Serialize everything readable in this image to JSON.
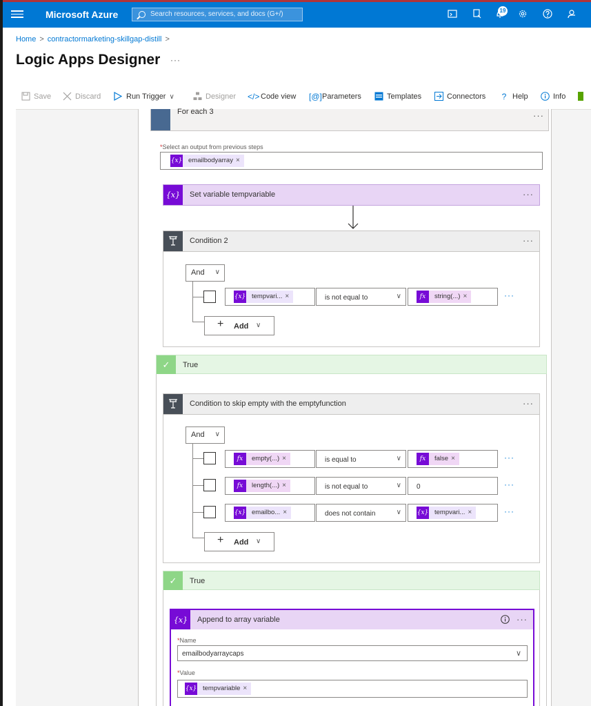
{
  "topbar": {
    "brand": "Microsoft Azure",
    "search_placeholder": "Search resources, services, and docs (G+/)",
    "notification_count": "19"
  },
  "breadcrumb": {
    "items": [
      "Home",
      "contractormarketing-skillgap-distill"
    ]
  },
  "page": {
    "title": "Logic Apps Designer",
    "more": "···"
  },
  "toolbar": {
    "save": "Save",
    "discard": "Discard",
    "run_trigger": "Run Trigger",
    "designer": "Designer",
    "code_view": "Code view",
    "parameters": "Parameters",
    "templates": "Templates",
    "connectors": "Connectors",
    "help": "Help",
    "info": "Info"
  },
  "foreach": {
    "title": "For each 3",
    "output_label": "Select an output from previous steps",
    "output_token": "emailbodyarray"
  },
  "set_variable": {
    "title": "Set variable tempvariable"
  },
  "condition2": {
    "title": "Condition 2",
    "and_label": "And",
    "row": {
      "left": "tempvari...",
      "operator": "is not equal to",
      "right": "string(...)"
    },
    "add_label": "Add"
  },
  "true_branch_1": {
    "label": "True"
  },
  "condition_skip": {
    "title": "Condition to skip empty with the emptyfunction",
    "and_label": "And",
    "rows": [
      {
        "left": "empty(...)",
        "operator": "is equal to",
        "right": "false"
      },
      {
        "left": "length(...)",
        "operator": "is not equal to",
        "right": "0"
      },
      {
        "left": "emailbo...",
        "operator": "does not contain",
        "right": "tempvari..."
      }
    ],
    "add_label": "Add"
  },
  "true_branch_2": {
    "label": "True"
  },
  "append": {
    "title": "Append to array variable",
    "name_label": "Name",
    "name_value": "emailbodyarraycaps",
    "value_label": "Value",
    "value_token": "tempvariable"
  },
  "icons": {
    "variable": "{x}",
    "function": "fx",
    "close": "×",
    "ellipsis": "···"
  },
  "colors": {
    "azure_blue": "#0078d4",
    "variable_purple": "#770bd6",
    "condition_gray": "#484f58",
    "true_green": "#8ed687",
    "foreach_blue": "#486991"
  }
}
